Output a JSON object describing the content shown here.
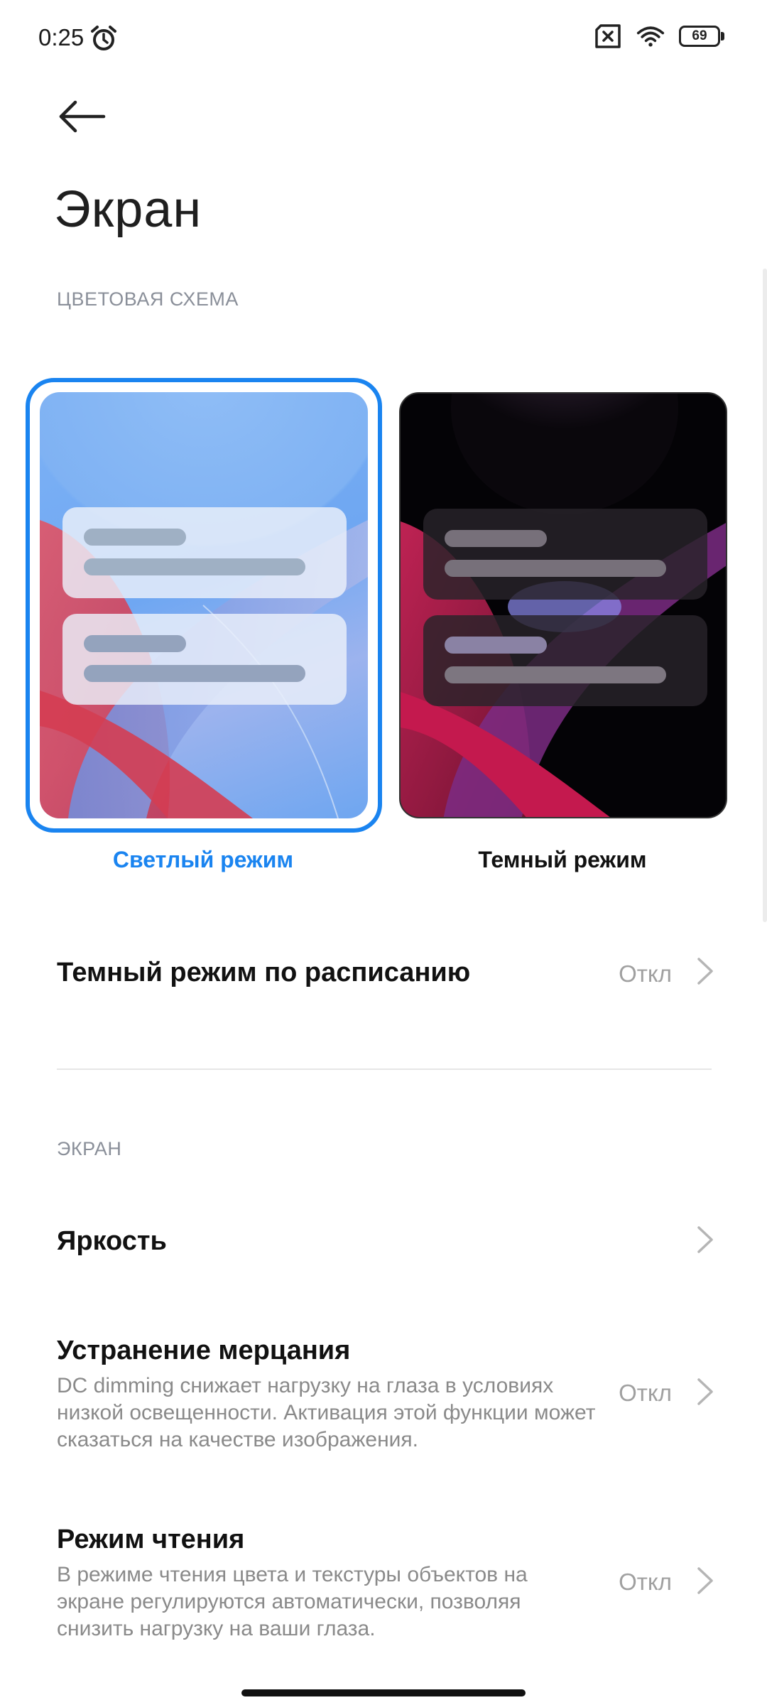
{
  "status_bar": {
    "time": "0:25",
    "battery": "69",
    "icons": [
      "alarm-icon",
      "no-sim-icon",
      "wifi-icon",
      "battery-icon"
    ]
  },
  "header": {
    "title": "Экран",
    "back_icon": "back-arrow-icon"
  },
  "color_scheme": {
    "section_label": "ЦВЕТОВАЯ СХЕМА",
    "modes": [
      {
        "label": "Светлый режим",
        "selected": true
      },
      {
        "label": "Темный режим",
        "selected": false
      }
    ],
    "accent_color": "#1a84f0"
  },
  "schedule_row": {
    "title": "Темный режим по расписанию",
    "value": "Откл"
  },
  "screen_section": {
    "section_label": "ЭКРАН",
    "items": [
      {
        "title": "Яркость",
        "description": "",
        "value": ""
      },
      {
        "title": "Устранение мерцания",
        "description": "DC dimming снижает нагрузку на глаза в условиях низкой освещенности. Активация этой функции может сказаться на качестве изображения.",
        "value": "Откл"
      },
      {
        "title": "Режим чтения",
        "description": "В режиме чтения цвета и текстуры объектов на экране регулируются автоматически, позволяя снизить нагрузку на ваши глаза.",
        "value": "Откл"
      }
    ]
  }
}
